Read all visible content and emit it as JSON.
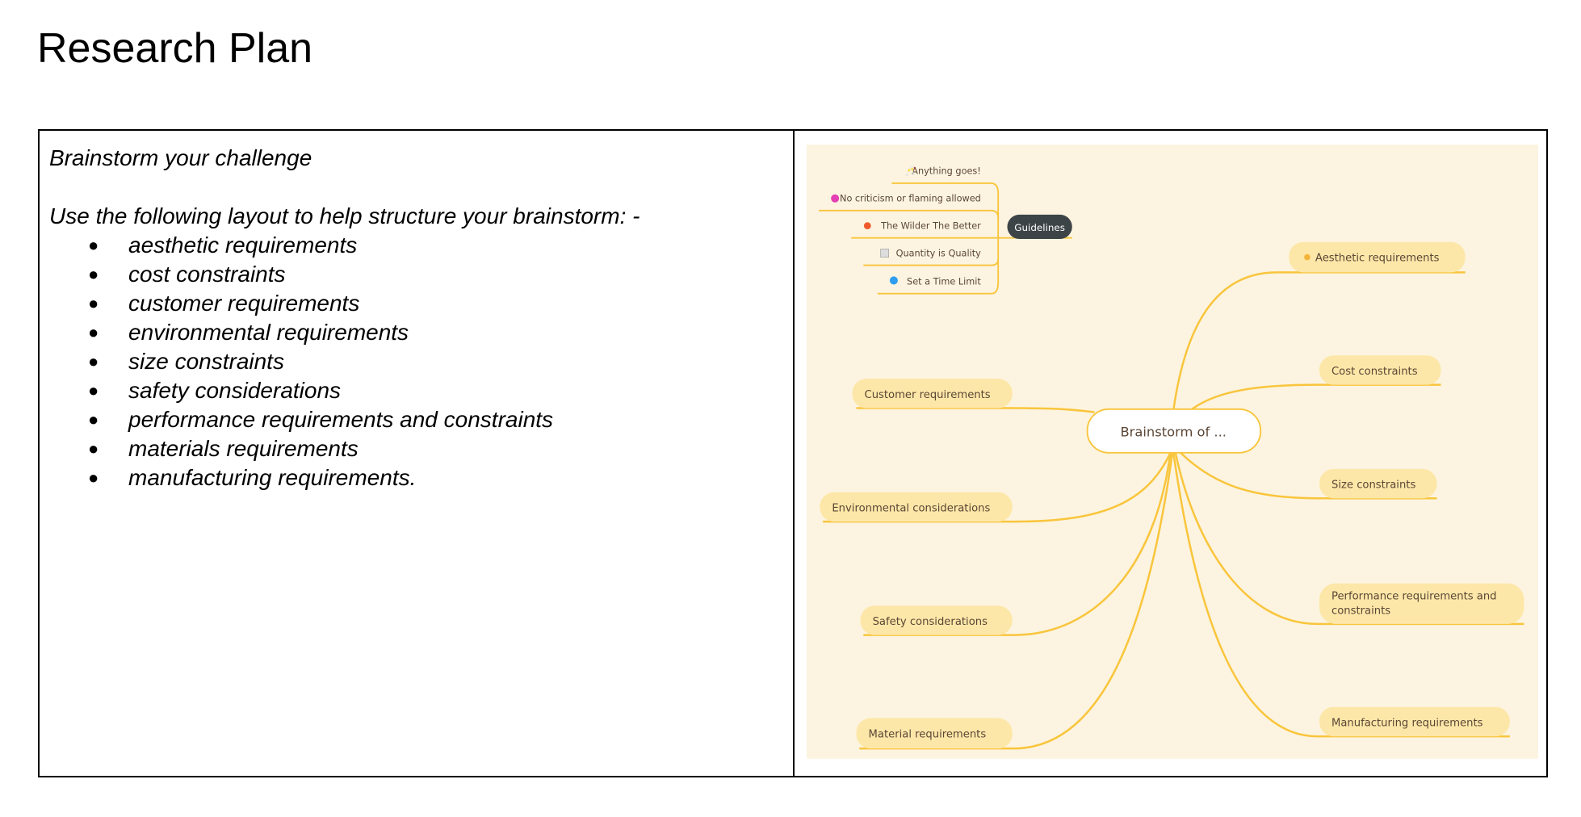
{
  "title": "Research Plan",
  "left": {
    "heading": "Brainstorm your challenge",
    "intro": "Use the following layout to help structure your brainstorm: -",
    "items": [
      "aesthetic requirements",
      "cost constraints",
      "customer requirements",
      "environmental requirements",
      "size constraints",
      "safety considerations",
      "performance requirements and constraints",
      "materials requirements",
      "manufacturing requirements."
    ]
  },
  "mindmap": {
    "colors": {
      "background": "#fcf4e0",
      "branch": "#f9c53c",
      "pill": "#fde7a8",
      "guidelines_node": "#3d4448"
    },
    "center": "Brainstorm of ...",
    "guidelines": {
      "label": "Guidelines",
      "items": [
        {
          "icon": "clinking-glasses-icon",
          "text": "Anything goes!"
        },
        {
          "icon": "heart-icon",
          "text": "No criticism or flaming allowed"
        },
        {
          "icon": "explosion-icon",
          "text": "The Wilder The Better"
        },
        {
          "icon": "chart-icon",
          "text": "Quantity is Quality"
        },
        {
          "icon": "clock-icon",
          "text": "Set a Time Limit"
        }
      ]
    },
    "right_branches": [
      "Aesthetic requirements",
      "Cost constraints",
      "Size constraints",
      "Performance requirements and",
      "constraints",
      "Manufacturing requirements"
    ],
    "left_branches": [
      "Customer requirements",
      "Environmental considerations",
      "Safety considerations",
      "Material requirements"
    ]
  }
}
